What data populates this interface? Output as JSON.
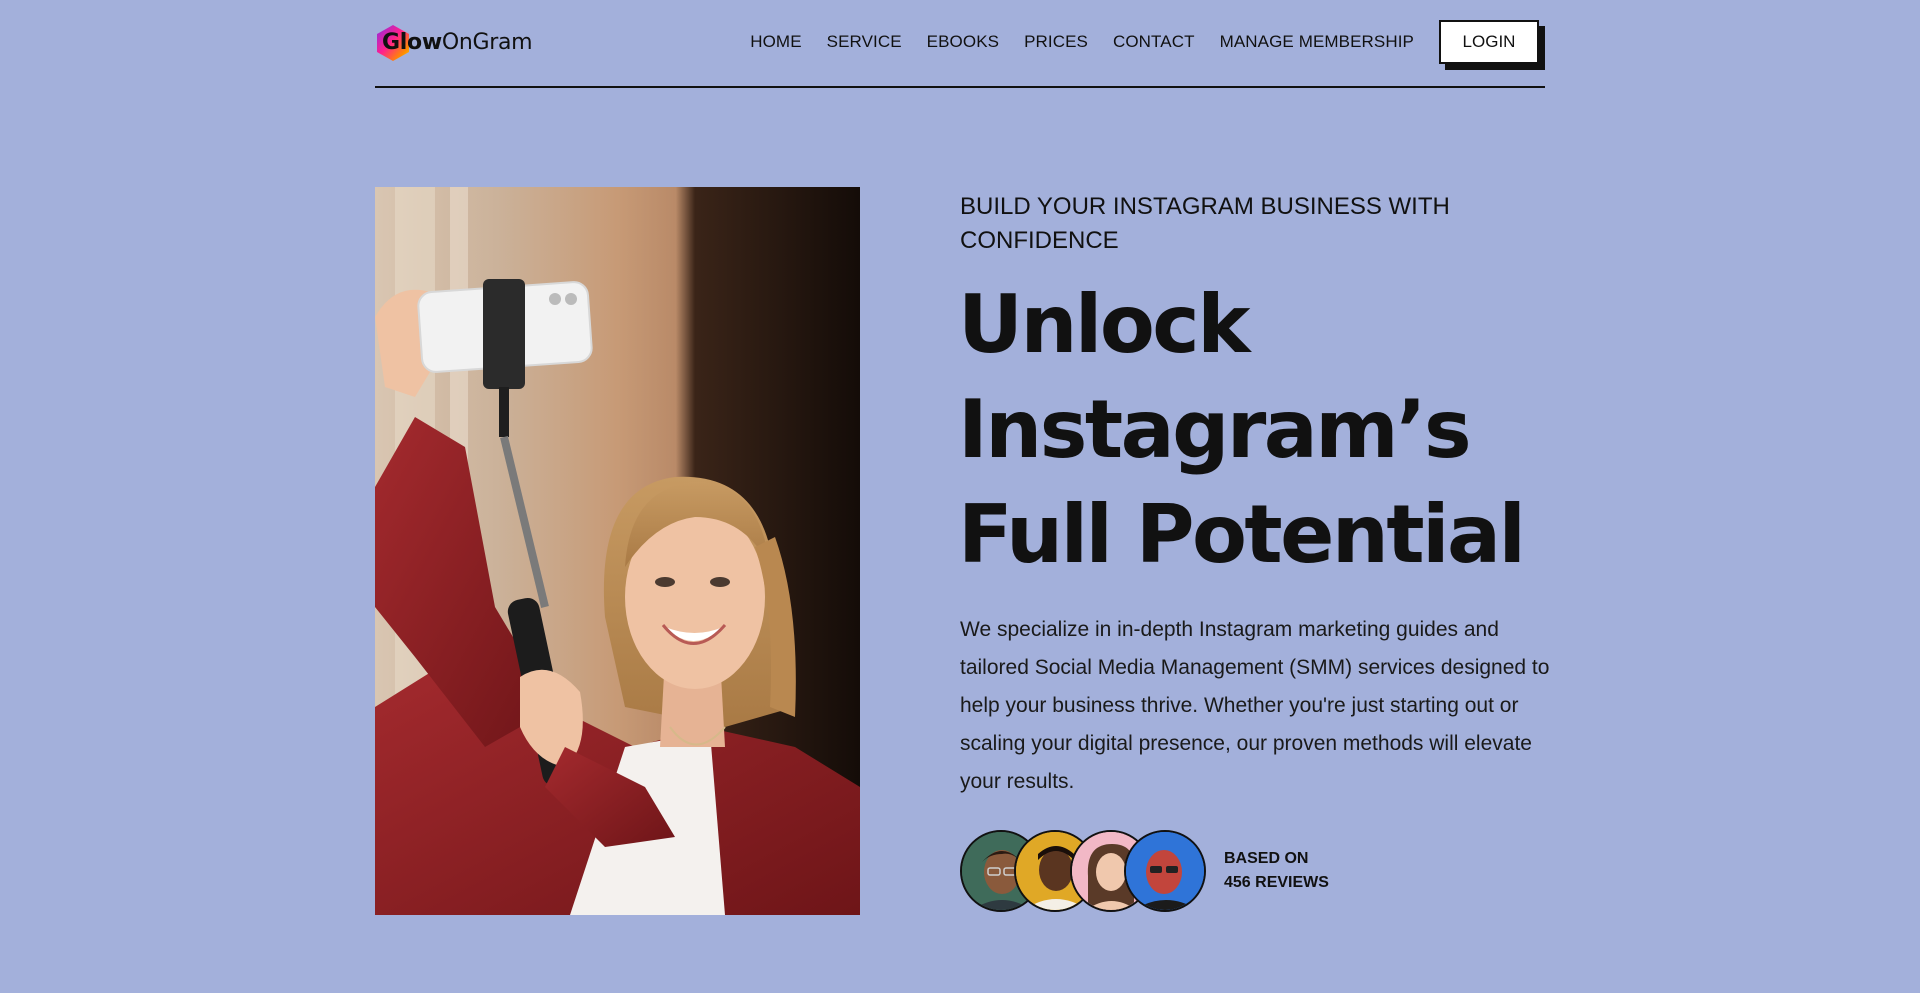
{
  "brand": {
    "name_bold": "Glow",
    "name_regular": "OnGram"
  },
  "nav": {
    "items": [
      {
        "label": "HOME"
      },
      {
        "label": "SERVICE"
      },
      {
        "label": "EBOOKS"
      },
      {
        "label": "PRICES"
      },
      {
        "label": "CONTACT"
      },
      {
        "label": "MANAGE MEMBERSHIP"
      }
    ],
    "login_label": "LOGIN"
  },
  "hero": {
    "eyebrow": "BUILD YOUR INSTAGRAM BUSINESS WITH CONFIDENCE",
    "headline": [
      "Unlock",
      "Instagram’s",
      "Full Potential"
    ],
    "body": "We specialize in in-depth Instagram marketing guides and tailored Social Media Management (SMM) services designed to help your business thrive. Whether you're just starting out or scaling your digital presence, our proven methods will elevate your results.",
    "image_icon": "woman-taking-selfie-photo"
  },
  "reviews": {
    "line1": "BASED ON",
    "line2": "456 REVIEWS",
    "avatars": [
      {
        "icon": "reviewer-avatar-1",
        "bg": "#3f6b5a"
      },
      {
        "icon": "reviewer-avatar-2",
        "bg": "#e0a826"
      },
      {
        "icon": "reviewer-avatar-3",
        "bg": "#f2b8c6"
      },
      {
        "icon": "reviewer-avatar-4",
        "bg": "#2f74d8"
      }
    ]
  },
  "colors": {
    "background": "#a3b0db",
    "text": "#111111",
    "button_bg": "#ffffff"
  }
}
